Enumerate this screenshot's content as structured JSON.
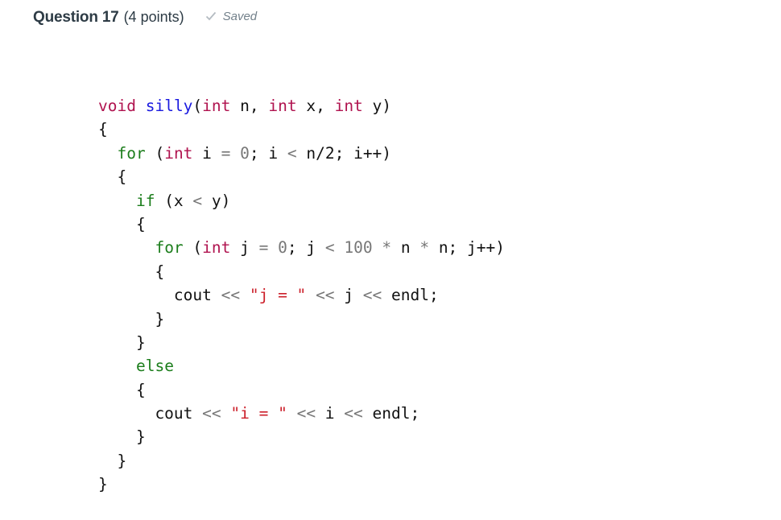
{
  "header": {
    "question_title": "Question 17",
    "points": "(4 points)",
    "status_icon": "checkmark-icon",
    "status_text": "Saved"
  },
  "code": {
    "language": "cpp",
    "lines": [
      [
        {
          "t": "void",
          "c": "kw-type"
        },
        {
          "t": " ",
          "c": "id"
        },
        {
          "t": "silly",
          "c": "fn"
        },
        {
          "t": "(",
          "c": "id"
        },
        {
          "t": "int",
          "c": "kw-type"
        },
        {
          "t": " n, ",
          "c": "id"
        },
        {
          "t": "int",
          "c": "kw-type"
        },
        {
          "t": " x, ",
          "c": "id"
        },
        {
          "t": "int",
          "c": "kw-type"
        },
        {
          "t": " y)",
          "c": "id"
        }
      ],
      [
        {
          "t": "{",
          "c": "id"
        }
      ],
      [
        {
          "t": "  ",
          "c": "id"
        },
        {
          "t": "for",
          "c": "kw-ctrl"
        },
        {
          "t": " (",
          "c": "id"
        },
        {
          "t": "int",
          "c": "kw-type"
        },
        {
          "t": " i ",
          "c": "id"
        },
        {
          "t": "=",
          "c": "op"
        },
        {
          "t": " ",
          "c": "id"
        },
        {
          "t": "0",
          "c": "num"
        },
        {
          "t": "; i ",
          "c": "id"
        },
        {
          "t": "<",
          "c": "op"
        },
        {
          "t": " n/2; i++)",
          "c": "id"
        }
      ],
      [
        {
          "t": "  {",
          "c": "id"
        }
      ],
      [
        {
          "t": "    ",
          "c": "id"
        },
        {
          "t": "if",
          "c": "kw-ctrl"
        },
        {
          "t": " (x ",
          "c": "id"
        },
        {
          "t": "<",
          "c": "op"
        },
        {
          "t": " y)",
          "c": "id"
        }
      ],
      [
        {
          "t": "    {",
          "c": "id"
        }
      ],
      [
        {
          "t": "      ",
          "c": "id"
        },
        {
          "t": "for",
          "c": "kw-ctrl"
        },
        {
          "t": " (",
          "c": "id"
        },
        {
          "t": "int",
          "c": "kw-type"
        },
        {
          "t": " j ",
          "c": "id"
        },
        {
          "t": "=",
          "c": "op"
        },
        {
          "t": " ",
          "c": "id"
        },
        {
          "t": "0",
          "c": "num"
        },
        {
          "t": "; j ",
          "c": "id"
        },
        {
          "t": "<",
          "c": "op"
        },
        {
          "t": " ",
          "c": "id"
        },
        {
          "t": "100",
          "c": "num"
        },
        {
          "t": " ",
          "c": "id"
        },
        {
          "t": "*",
          "c": "op"
        },
        {
          "t": " n ",
          "c": "id"
        },
        {
          "t": "*",
          "c": "op"
        },
        {
          "t": " n; j++)",
          "c": "id"
        }
      ],
      [
        {
          "t": "      {",
          "c": "id"
        }
      ],
      [
        {
          "t": "        cout ",
          "c": "id"
        },
        {
          "t": "<<",
          "c": "op"
        },
        {
          "t": " ",
          "c": "id"
        },
        {
          "t": "\"j = \"",
          "c": "str"
        },
        {
          "t": " ",
          "c": "id"
        },
        {
          "t": "<<",
          "c": "op"
        },
        {
          "t": " j ",
          "c": "id"
        },
        {
          "t": "<<",
          "c": "op"
        },
        {
          "t": " endl;",
          "c": "id"
        }
      ],
      [
        {
          "t": "      }",
          "c": "id"
        }
      ],
      [
        {
          "t": "    }",
          "c": "id"
        }
      ],
      [
        {
          "t": "    ",
          "c": "id"
        },
        {
          "t": "else",
          "c": "kw-ctrl"
        }
      ],
      [
        {
          "t": "    {",
          "c": "id"
        }
      ],
      [
        {
          "t": "      cout ",
          "c": "id"
        },
        {
          "t": "<<",
          "c": "op"
        },
        {
          "t": " ",
          "c": "id"
        },
        {
          "t": "\"i = \"",
          "c": "str"
        },
        {
          "t": " ",
          "c": "id"
        },
        {
          "t": "<<",
          "c": "op"
        },
        {
          "t": " i ",
          "c": "id"
        },
        {
          "t": "<<",
          "c": "op"
        },
        {
          "t": " endl;",
          "c": "id"
        }
      ],
      [
        {
          "t": "    }",
          "c": "id"
        }
      ],
      [
        {
          "t": "  }",
          "c": "id"
        }
      ],
      [
        {
          "t": "}",
          "c": "id"
        }
      ]
    ]
  }
}
